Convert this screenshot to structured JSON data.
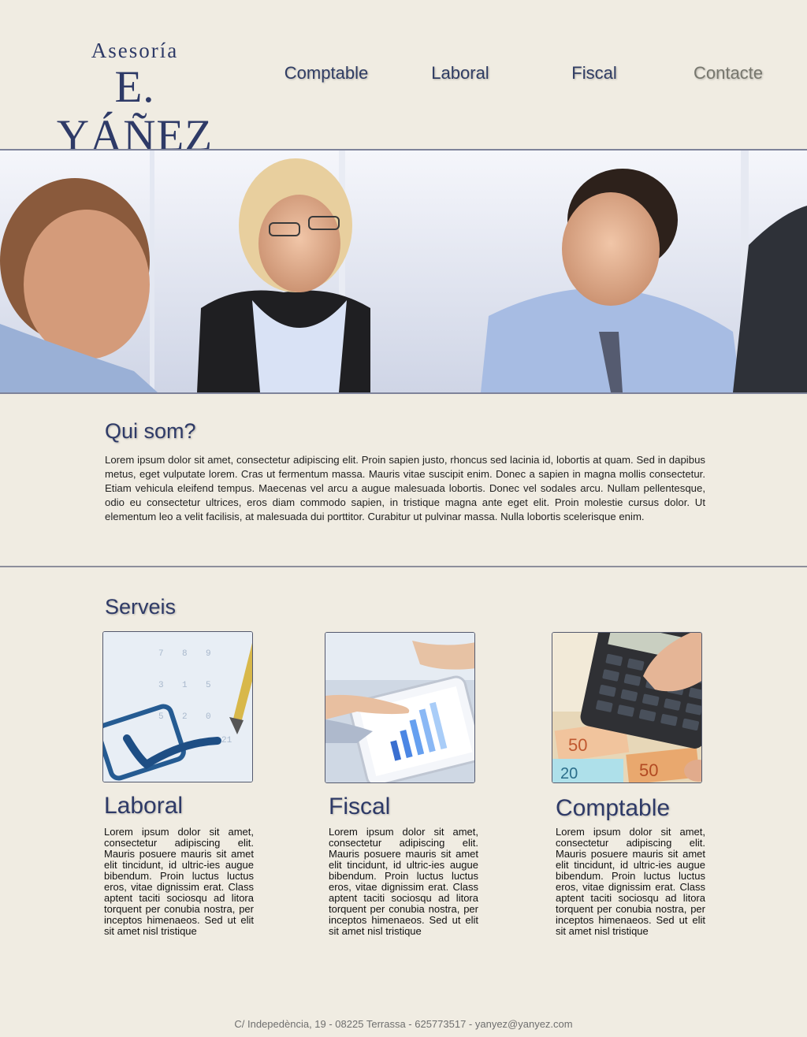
{
  "logo": {
    "line1": "Asesoría",
    "line2": "E. YÁÑEZ"
  },
  "nav": [
    {
      "label": "Comptable"
    },
    {
      "label": "Laboral"
    },
    {
      "label": "Fiscal"
    },
    {
      "label": "Contacte"
    }
  ],
  "about": {
    "title": "Qui som?",
    "text": "  Lorem ipsum dolor sit amet, consectetur adipiscing elit. Proin sapien justo, rhoncus sed lacinia id, lobortis at quam. Sed in dapibus metus, eget vulputate lorem. Cras ut fermentum massa. Mauris vitae suscipit enim. Donec a sapien in magna mollis consectetur. Etiam vehicula eleifend tempus. Maecenas vel arcu a augue malesuada lobortis. Donec vel sodales arcu. Nullam pellentesque, odio eu consectetur ultrices, eros diam commodo sapien, in tristique magna ante eget elit. Proin molestie cursus dolor. Ut elementum leo a velit facilisis, at malesuada dui porttitor. Curabitur ut pulvinar massa. Nulla lobortis scelerisque enim."
  },
  "services": {
    "title": "Serveis",
    "items": [
      {
        "title": "Laboral",
        "text": "  Lorem ipsum dolor sit amet, consectetur adipiscing elit. Mauris posuere mauris sit amet elit tincidunt, id ultric-ies augue bibendum. Proin luctus luctus eros, vitae dignissim erat. Class aptent taciti sociosqu ad litora torquent per conubia nostra, per inceptos himenaeos. Sed ut elit sit amet nisl tristique"
      },
      {
        "title": "Fiscal",
        "text": "  Lorem ipsum dolor sit amet, consectetur adipiscing elit. Mauris posuere mauris sit amet elit tincidunt, id ultric-ies augue bibendum. Proin luctus luctus eros, vitae dignissim erat. Class aptent taciti sociosqu ad litora torquent per conubia nostra, per inceptos himenaeos. Sed ut elit sit amet nisl tristique"
      },
      {
        "title": "Comptable",
        "text": "  Lorem ipsum dolor sit amet, consectetur adipiscing elit. Mauris posuere mauris sit amet elit tincidunt, id ultric-ies augue bibendum. Proin luctus luctus eros, vitae dignissim erat. Class aptent taciti sociosqu ad litora torquent per conubia nostra, per inceptos himenaeos. Sed ut elit sit amet nisl tristique"
      }
    ]
  },
  "footer": {
    "text": "C/ Indepedència, 19 - 08225 Terrassa - 625773517 -  yanyez@yanyez.com"
  }
}
